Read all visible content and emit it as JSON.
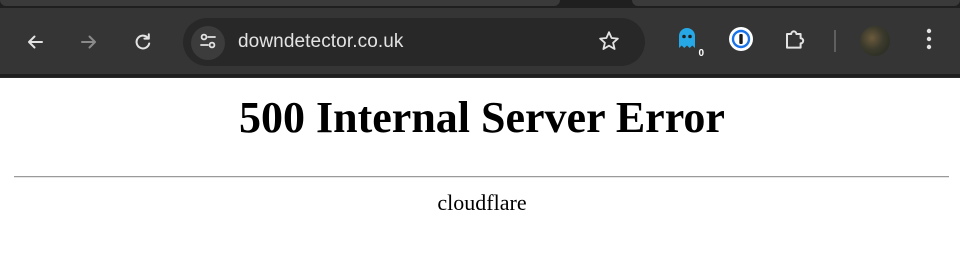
{
  "browser": {
    "url": "downdetector.co.uk",
    "extensions": [
      {
        "name": "ghostery-extension",
        "badge": "0"
      },
      {
        "name": "1password-extension"
      }
    ],
    "colors": {
      "toolbar": "#353535",
      "omnibox": "#282828",
      "icon": "#e3e3e3",
      "icon_disabled": "#8a8a8a"
    }
  },
  "page": {
    "heading": "500 Internal Server Error",
    "server": "cloudflare"
  }
}
